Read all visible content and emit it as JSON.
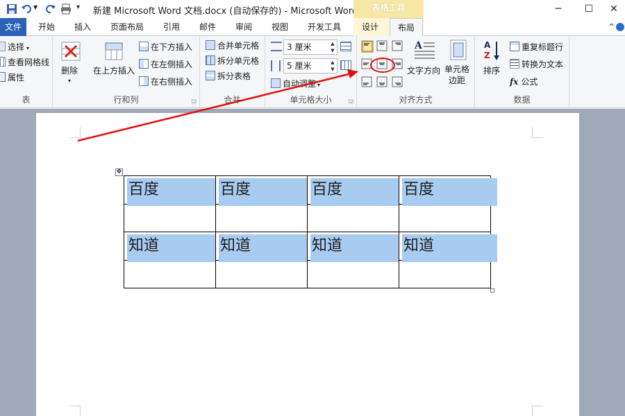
{
  "window": {
    "title": "新建 Microsoft Word 文档.docx (自动保存的)  -  Microsoft Word",
    "context_tab_group": "表格工具",
    "controls": {
      "minimize": "─",
      "maximize": "☐",
      "close": "✕"
    }
  },
  "tabs": [
    {
      "label": "文件"
    },
    {
      "label": "开始"
    },
    {
      "label": "插入"
    },
    {
      "label": "页面布局"
    },
    {
      "label": "引用"
    },
    {
      "label": "邮件"
    },
    {
      "label": "审阅"
    },
    {
      "label": "视图"
    },
    {
      "label": "开发工具"
    },
    {
      "label": "设计"
    },
    {
      "label": "布局",
      "active": true
    }
  ],
  "ribbon": {
    "table_group": {
      "label": "表",
      "items": [
        "选择",
        "查看网格线",
        "属性"
      ]
    },
    "rows_cols_group": {
      "label": "行和列",
      "delete": "删除",
      "insert_above": "在上方插入",
      "insert_below": "在下方插入",
      "insert_left": "在左侧插入",
      "insert_right": "在右侧插入"
    },
    "merge_group": {
      "label": "合并",
      "merge_cells": "合并单元格",
      "split_cells": "拆分单元格",
      "split_table": "拆分表格"
    },
    "cell_size_group": {
      "label": "单元格大小",
      "height_value": "3 厘米",
      "width_value": "5 厘米",
      "autofit": "自动调整"
    },
    "alignment_group": {
      "label": "对齐方式",
      "text_direction": "文字方向",
      "cell_margins": "单元格边距"
    },
    "data_group": {
      "label": "数据",
      "sort": "排序",
      "repeat_header": "重复标题行",
      "convert_to_text": "转换为文本",
      "formula": "公式"
    }
  },
  "table": {
    "rows": [
      [
        "百度",
        "百度",
        "百度",
        "百度"
      ],
      [
        "知道",
        "知道",
        "知道",
        "知道"
      ]
    ]
  },
  "colors": {
    "file_tab": "#2a62b8",
    "context_header": "#f7e7a4",
    "highlight": "#a8cbf0",
    "annotation": "#e01010"
  }
}
